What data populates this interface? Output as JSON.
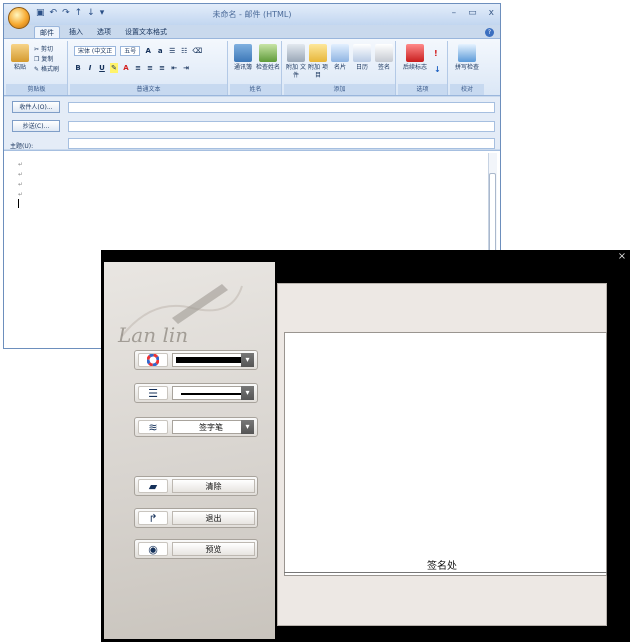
{
  "outlook": {
    "title": "未命名 - 邮件 (HTML)",
    "window_controls": [
      "–",
      "▭",
      "x"
    ],
    "tabs": [
      "邮件",
      "插入",
      "选项",
      "设置文本格式"
    ],
    "active_tab": "邮件",
    "clipboard": {
      "paste": "粘贴",
      "cut": "剪切",
      "copy": "复制",
      "format_painter": "格式刷",
      "group": "剪贴板"
    },
    "basic_text": {
      "font": "宋体 (中文正",
      "size": "五号",
      "group": "普通文本"
    },
    "names": {
      "address_book": "通讯簿",
      "check_names": "检查姓名",
      "group": "姓名"
    },
    "include": {
      "attach_file": "附加\n文件",
      "attach_item": "附加\n项目",
      "business_card": "名片",
      "calendar": "日历",
      "signature": "签名",
      "group": "添加"
    },
    "options": {
      "follow_up": "后续标志",
      "group": "选项"
    },
    "proofing": {
      "spelling": "拼写检查",
      "group": "校对"
    },
    "to_button": "收件人(O)...",
    "cc_button": "抄送(C)...",
    "subject_label": "主题(U):",
    "paragraph_marks": [
      "↵",
      "↵",
      "↵",
      "↵"
    ]
  },
  "signature_dialog": {
    "close": "×",
    "logo_text": "Lan lin",
    "icons": {
      "color": "color-wheel-icon",
      "width": "line-width-icon",
      "pen": "pen-type-icon",
      "clear": "eraser-icon",
      "exit": "exit-icon",
      "preview": "eye-icon"
    },
    "pen_type": "签字笔",
    "clear_label": "清除",
    "exit_label": "退出",
    "preview_label": "预览",
    "signature_area_label": "签名处",
    "colors": {
      "pen": "#000000",
      "window": "#000000"
    }
  }
}
